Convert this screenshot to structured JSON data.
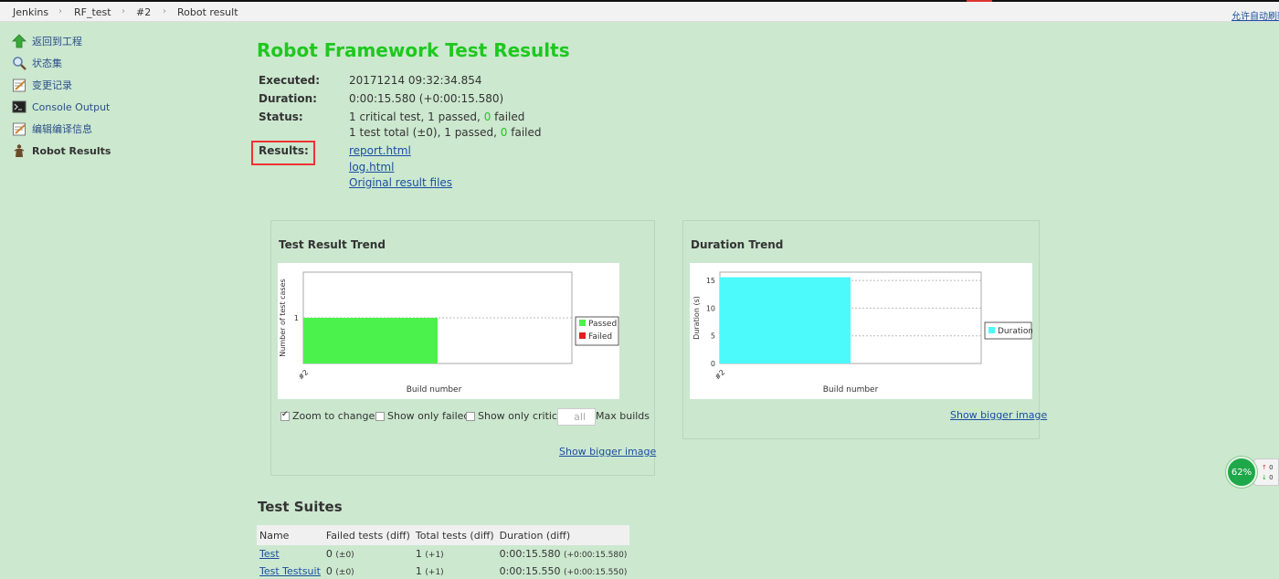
{
  "breadcrumb": {
    "items": [
      "Jenkins",
      "RF_test",
      "#2",
      "Robot result"
    ],
    "right_link": "允许自动刷新"
  },
  "sidebar": {
    "items": [
      {
        "label": "返回到工程",
        "icon": "up-arrow-icon"
      },
      {
        "label": "状态集",
        "icon": "magnifier-icon"
      },
      {
        "label": "变更记录",
        "icon": "notepad-icon"
      },
      {
        "label": "Console Output",
        "icon": "terminal-icon"
      },
      {
        "label": "编辑编译信息",
        "icon": "notepad-edit-icon"
      },
      {
        "label": "Robot Results",
        "icon": "robot-icon"
      }
    ]
  },
  "main": {
    "title": "Robot Framework Test Results",
    "executed_label": "Executed:",
    "executed_value": "20171214 09:32:34.854",
    "duration_label": "Duration:",
    "duration_value": "0:00:15.580 (+0:00:15.580)",
    "status_label": "Status:",
    "status_line1_pre": "1 critical test, 1 passed, ",
    "status_line1_fail": "0",
    "status_line1_post": " failed",
    "status_line2_pre": "1 test total (±0), 1 passed, ",
    "status_line2_fail": "0",
    "status_line2_post": " failed",
    "results_label": "Results:",
    "links": [
      "report.html",
      "log.html",
      "Original result files"
    ]
  },
  "trend_panel": {
    "title": "Test Result Trend",
    "options": {
      "zoom_label": "Zoom to changes",
      "only_failed_label": "Show only failed",
      "only_critical_label": "Show only critical",
      "max_builds_value": "all",
      "max_builds_label": "Max builds"
    },
    "bigger_link": "Show bigger image"
  },
  "duration_panel": {
    "title": "Duration Trend",
    "bigger_link": "Show bigger image"
  },
  "chart_data": [
    {
      "type": "area",
      "title": "",
      "xlabel": "Build number",
      "ylabel": "Number of test cases",
      "categories": [
        "#2"
      ],
      "yticks": [
        "1"
      ],
      "series": [
        {
          "name": "Passed",
          "values": [
            1
          ],
          "color": "#4cf24c"
        },
        {
          "name": "Failed",
          "values": [
            0
          ],
          "color": "#e02020"
        }
      ],
      "legend": "right",
      "grid": true
    },
    {
      "type": "bar",
      "title": "",
      "xlabel": "Build number",
      "ylabel": "Duration (s)",
      "categories": [
        "#2"
      ],
      "yticks": [
        "0",
        "5",
        "10",
        "15"
      ],
      "ylim": [
        0,
        16.5
      ],
      "series": [
        {
          "name": "Duration",
          "values": [
            15.58
          ],
          "color": "#4cf9fb"
        }
      ],
      "legend": "right",
      "grid": true
    }
  ],
  "suites": {
    "title": "Test Suites",
    "headers": [
      "Name",
      "Failed tests (diff)",
      "Total tests (diff)",
      "Duration (diff)"
    ],
    "rows": [
      {
        "name": "Test",
        "failed": "0",
        "failed_diff": "(±0)",
        "total": "1",
        "total_diff": "(+1)",
        "duration": "0:00:15.580",
        "duration_diff": "(+0:00:15.580)"
      },
      {
        "name": "Test Testsuit",
        "failed": "0",
        "failed_diff": "(±0)",
        "total": "1",
        "total_diff": "(+1)",
        "duration": "0:00:15.550",
        "duration_diff": "(+0:00:15.550)"
      }
    ]
  },
  "badge": {
    "percent": "62%",
    "tab_line1": "0",
    "tab_line2": "0"
  },
  "colors": {
    "background": "#cce8cf",
    "title_green": "#1ec81e",
    "link_blue": "#1a4fa0",
    "highlight_red": "#e33333"
  }
}
